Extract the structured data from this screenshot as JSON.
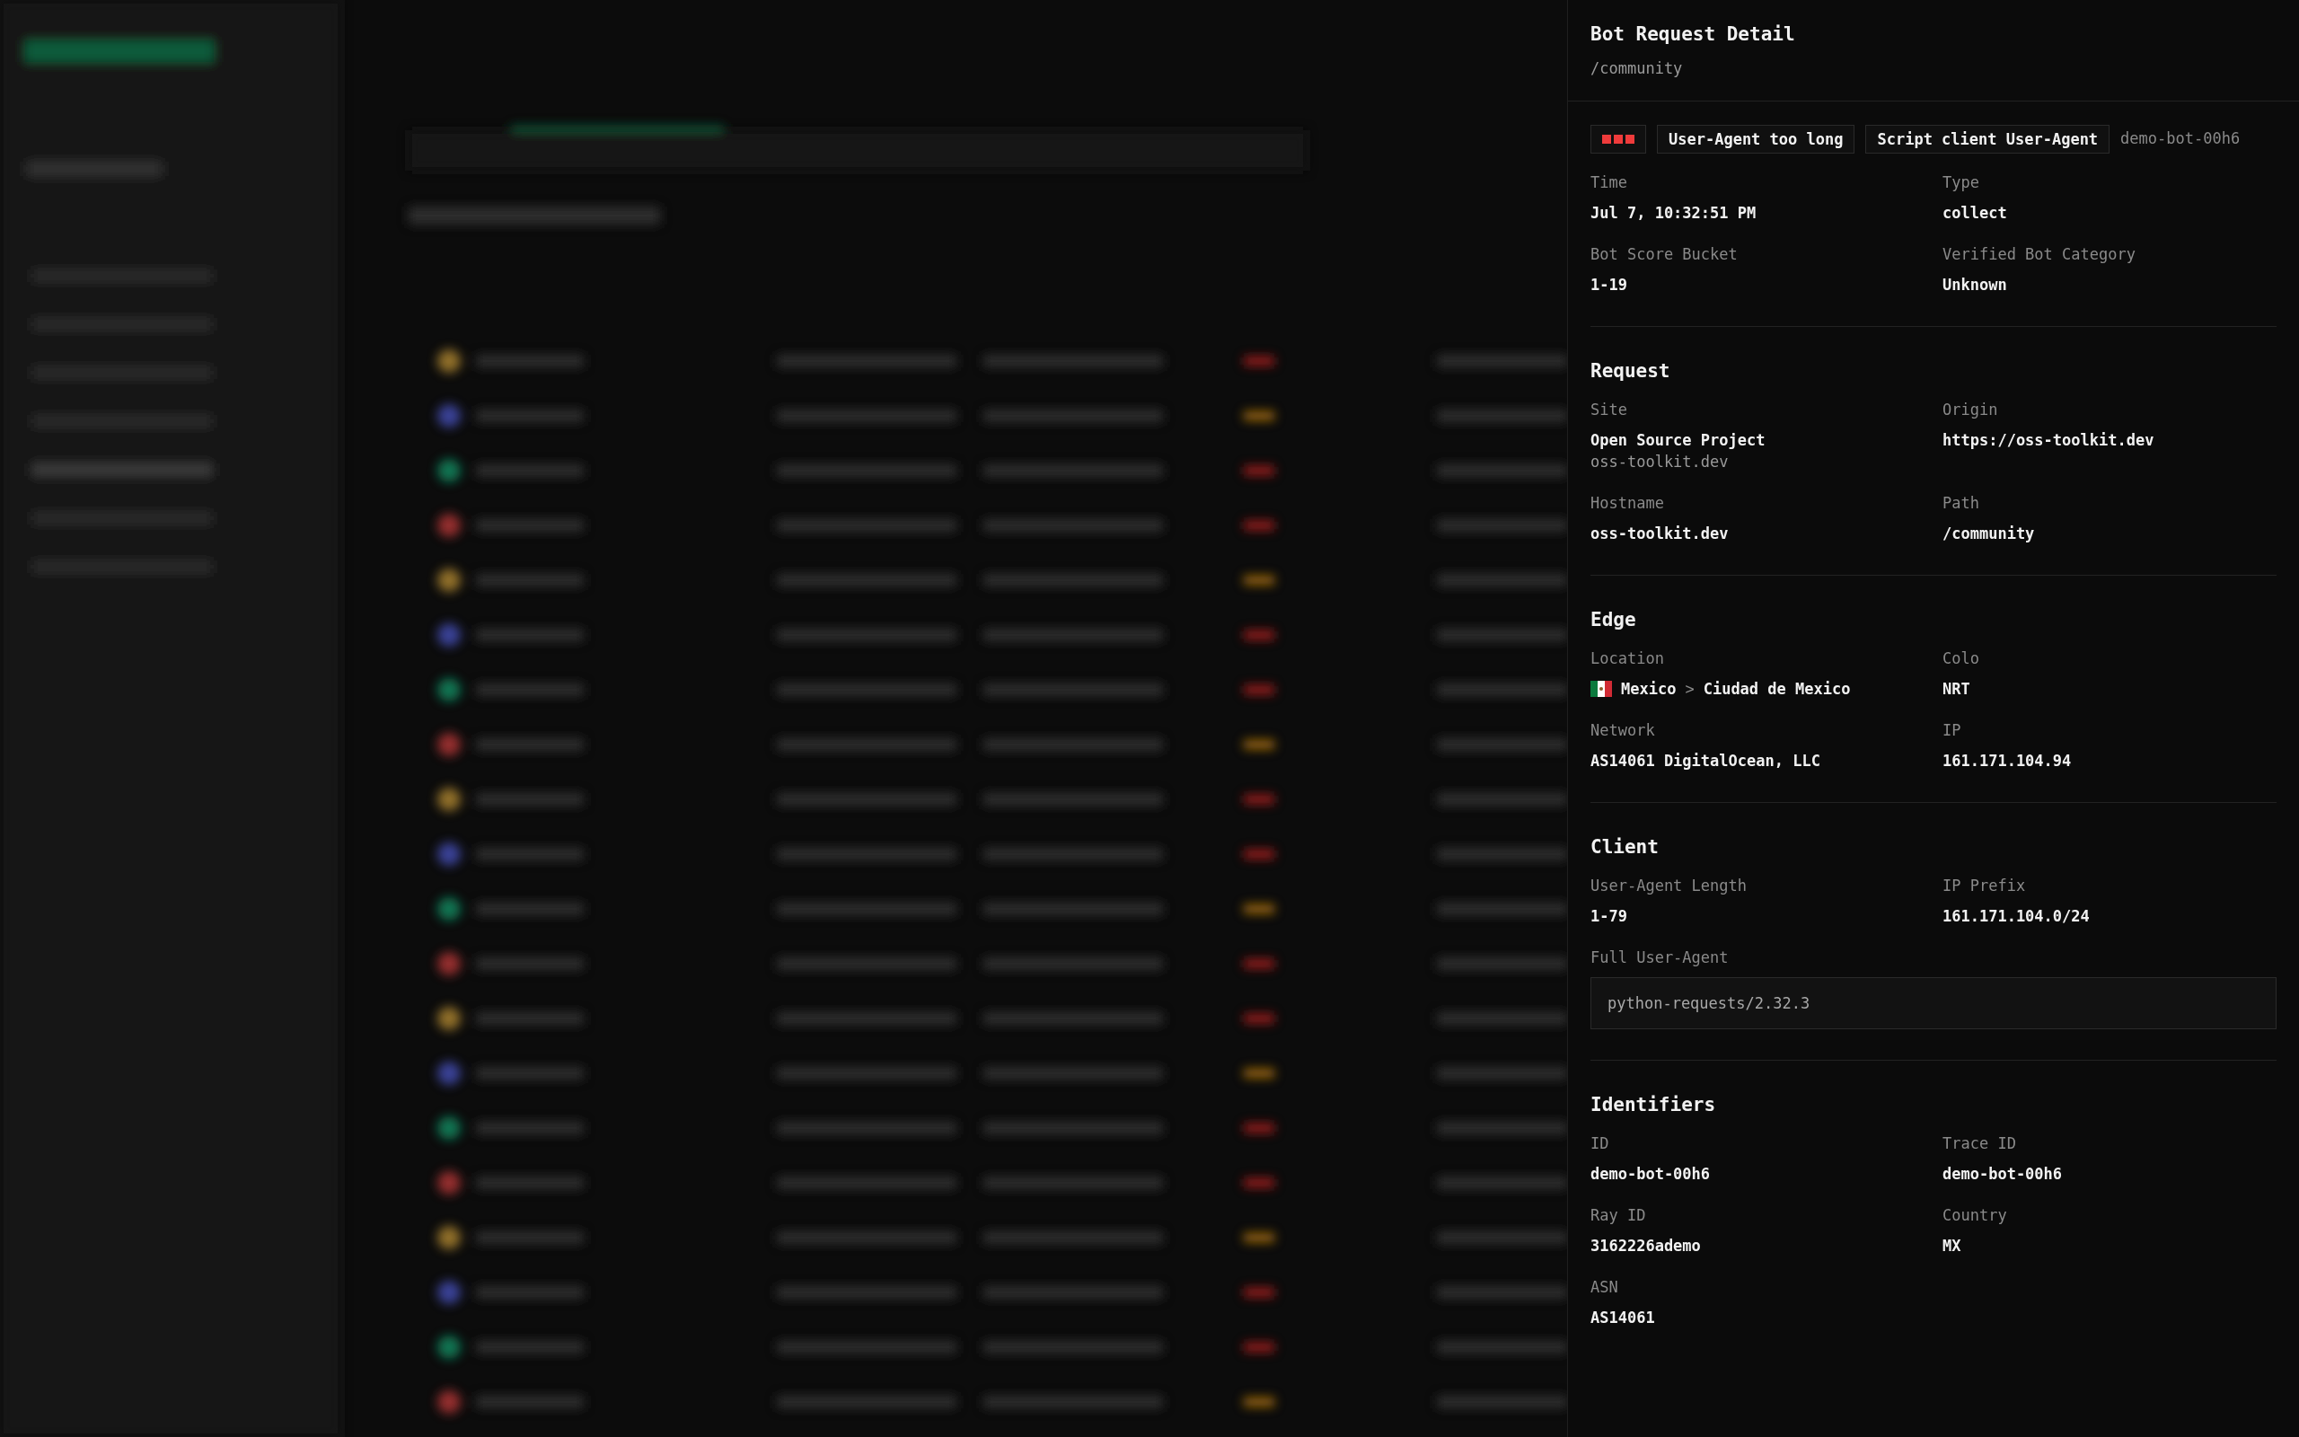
{
  "panel": {
    "title": "Bot Request Detail",
    "subtitle": "/community",
    "badges": [
      "User-Agent too long",
      "Script client User-Agent"
    ],
    "request_id": "demo-bot-00h6",
    "summary": [
      {
        "label": "Time",
        "value": "Jul 7, 10:32:51 PM"
      },
      {
        "label": "Type",
        "value": "collect"
      },
      {
        "label": "Bot Score Bucket",
        "value": "1-19"
      },
      {
        "label": "Verified Bot Category",
        "value": "Unknown"
      }
    ],
    "sections": [
      {
        "title": "Request",
        "fields": [
          {
            "label": "Site",
            "value": "Open Source Project",
            "secondary": "oss-toolkit.dev"
          },
          {
            "label": "Origin",
            "value": "https://oss-toolkit.dev"
          },
          {
            "label": "Hostname",
            "value": "oss-toolkit.dev"
          },
          {
            "label": "Path",
            "value": "/community"
          }
        ]
      },
      {
        "title": "Edge",
        "fields": [
          {
            "kind": "location",
            "label": "Location",
            "country": "Mexico",
            "separator": ">",
            "city": "Ciudad de Mexico"
          },
          {
            "label": "Colo",
            "value": "NRT"
          },
          {
            "label": "Network",
            "value": "AS14061 DigitalOcean, LLC"
          },
          {
            "label": "IP",
            "value": "161.171.104.94"
          }
        ]
      },
      {
        "title": "Client",
        "fields": [
          {
            "label": "User-Agent Length",
            "value": "1-79"
          },
          {
            "label": "IP Prefix",
            "value": "161.171.104.0/24"
          },
          {
            "kind": "code",
            "label": "Full User-Agent",
            "value": "python-requests/2.32.3"
          }
        ]
      },
      {
        "title": "Identifiers",
        "fields": [
          {
            "label": "ID",
            "value": "demo-bot-00h6"
          },
          {
            "label": "Trace ID",
            "value": "demo-bot-00h6"
          },
          {
            "label": "Ray ID",
            "value": "3162226ademo"
          },
          {
            "label": "Country",
            "value": "MX"
          },
          {
            "label": "ASN",
            "value": "AS14061"
          }
        ]
      }
    ]
  }
}
